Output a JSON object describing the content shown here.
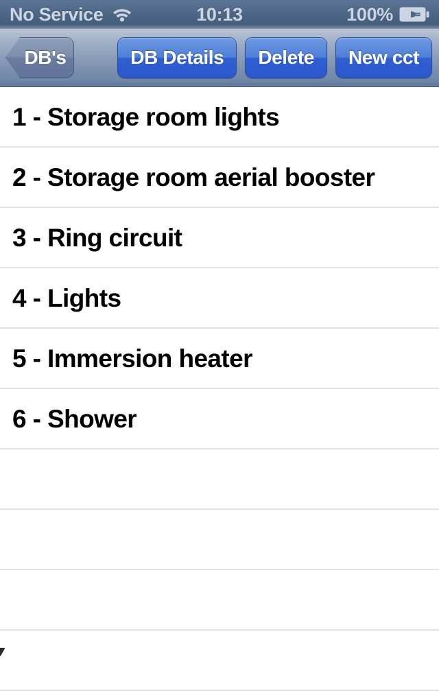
{
  "status_bar": {
    "carrier": "No Service",
    "wifi_icon": "wifi-icon",
    "time": "10:13",
    "battery_percent": "100%",
    "battery_icon": "battery-charging-icon",
    "text_color": "#ccd5e2",
    "background_color": "#4e6685"
  },
  "nav_bar": {
    "back_button": {
      "label": "DB's",
      "icon": "chevron-left-icon"
    },
    "buttons": [
      {
        "label": "DB Details",
        "name": "db-details-button"
      },
      {
        "label": "Delete",
        "name": "delete-button"
      },
      {
        "label": "New cct",
        "name": "new-cct-button"
      }
    ],
    "accent_color": "#2f5fd0",
    "background_color": "#8598b5"
  },
  "list": {
    "rows": [
      {
        "label": "1 - Storage room lights"
      },
      {
        "label": "2 - Storage room aerial booster"
      },
      {
        "label": "3 - Ring circuit"
      },
      {
        "label": "4 - Lights"
      },
      {
        "label": "5 - Immersion heater"
      },
      {
        "label": "6 - Shower"
      },
      {
        "label": ""
      },
      {
        "label": ""
      },
      {
        "label": ""
      },
      {
        "label": ""
      }
    ],
    "separator_color": "#e3e3e3",
    "text_color": "#000000",
    "background_color": "#ffffff"
  }
}
